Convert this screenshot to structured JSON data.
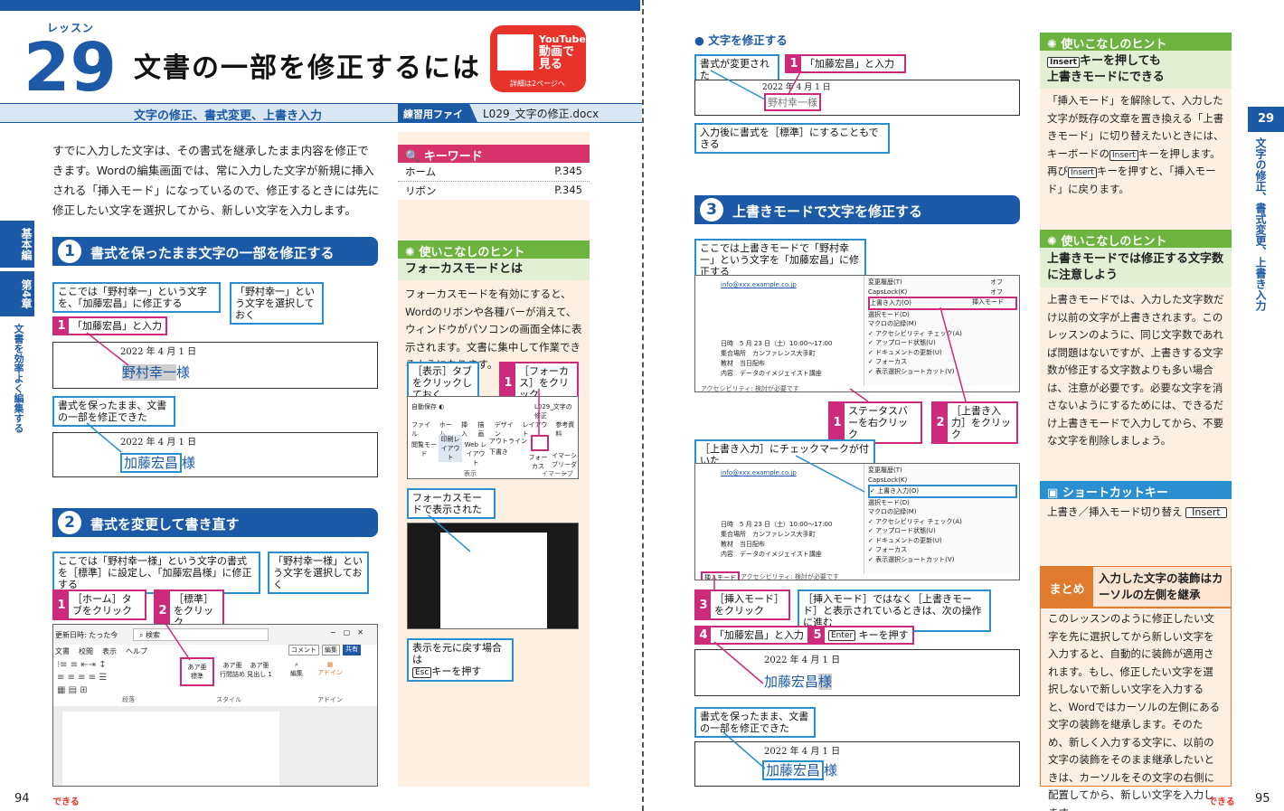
{
  "left": {
    "lesson_label": "レッスン",
    "lesson_number": "29",
    "title": "文書の一部を修正するには",
    "youtube": {
      "line1": "YouTube",
      "line2": "動画で",
      "line3": "見る",
      "note": "詳細は2ページへ"
    },
    "subtitle": "文字の修正、書式変更、上書き入力",
    "practice_label": "練習用ファイル",
    "practice_file": "L029_文字の修正.docx",
    "intro": "すでに入力した文字は、その書式を継承したまま内容を修正できます。Wordの編集画面では、常に入力した文字が新規に挿入される「挿入モード」になっているので、修正するときには先に修正したい文字を選択してから、新しい文字を入力します。",
    "side_tabs": [
      "基本編",
      "第4章",
      "文書を効率よく編集する"
    ],
    "sec1": {
      "no": "1",
      "title": "書式を保ったまま文字の一部を修正する",
      "c1": "ここでは「野村幸一」という文字を、「加藤宏昌」に修正する",
      "c2": "「野村幸一」という文字を選択しておく",
      "step_no": "1",
      "step": "「加藤宏昌」と入力",
      "date": "2022 年 4 月 1 日",
      "old": "野村幸一",
      "sama": "様",
      "c3": "書式を保ったまま、文書の一部を修正できた",
      "new": "加藤宏昌"
    },
    "sec2": {
      "no": "2",
      "title": "書式を変更して書き直す",
      "c1": "ここでは「野村幸一様」という文字の書式を［標準］に設定し、「加藤宏昌様」に修正する",
      "c2": "「野村幸一様」という文字を選択しておく",
      "s1_no": "1",
      "s1": "［ホーム］タブをクリック",
      "s2_no": "2",
      "s2": "［標準］をクリック",
      "ribbon": {
        "autosave": "更新日時: たった今",
        "search": "検索",
        "tabs": [
          "文書",
          "校閲",
          "表示",
          "ヘルプ"
        ],
        "comment": "コメント",
        "edit": "編集",
        "share": "共有",
        "style1": "あア亜",
        "style1b": "標準",
        "style2": "あア亜",
        "style2b": "行間詰め",
        "style3": "あア亜",
        "style3b": "見出し 1",
        "grp1": "段落",
        "grp2": "スタイル",
        "grp3": "アドイン",
        "edit2": "編集",
        "addin": "アドイン"
      }
    },
    "keyword": {
      "title": "キーワード",
      "items": [
        {
          "label": "ホーム",
          "page": "P.345"
        },
        {
          "label": "リボン",
          "page": "P.345"
        }
      ]
    },
    "hint1": {
      "title": "使いこなしのヒント",
      "sub": "フォーカスモードとは",
      "body": "フォーカスモードを有効にすると、Wordのリボンや各種バーが消えて、ウィンドウがパソコンの画面全体に表示されます。文書に集中して作業できるようになります。",
      "c1": "［表示］タブをクリックしておく",
      "s1_no": "1",
      "s1": "［フォーカス］をクリック",
      "ribbon": {
        "autosave": "自動保存",
        "file": "L029_文字の修正",
        "tabs": [
          "ファイル",
          "ホーム",
          "挿入",
          "描画",
          "デザイン",
          "レイアウト",
          "参考資料"
        ],
        "b1": "閲覧モード",
        "b2": "印刷レイアウト",
        "b3": "Web レイアウト",
        "b4": "アウトライン",
        "b5": "下書き",
        "b6": "フォーカス",
        "b7": "イマーシブリーダー",
        "g1": "表示",
        "g2": "イマーシブ"
      },
      "c2": "フォーカスモードで表示された",
      "c3a": "表示を元に戻す場合は",
      "c3_key": "Esc",
      "c3b": "キーを押す"
    }
  },
  "right": {
    "head": "文字を修正する",
    "top": {
      "c1": "書式が変更された",
      "s1_no": "1",
      "s1": "「加藤宏昌」と入力",
      "date": "2022 年 4 月 1 日",
      "text": "野村幸一様",
      "c2": "入力後に書式を［標準］にすることもできる"
    },
    "sec3": {
      "no": "3",
      "title": "上書きモードで文字を修正する",
      "c1": "ここでは上書きモードで「野村幸一」という文字を「加藤宏昌」に修正する",
      "s1_no": "1",
      "s1": "ステータスバーを右クリック",
      "s2_no": "2",
      "s2": "［上書き入力］をクリック",
      "c2": "［上書き入力］にチェックマークが付いた",
      "s3_no": "3",
      "s3": "［挿入モード］をクリック",
      "c3": "［挿入モード］ではなく［上書きモード］と表示されているときは、次の操作に進む",
      "s4_no": "4",
      "s4": "「加藤宏昌」と入力",
      "s5_no": "5",
      "s5_key": "Enter",
      "s5": "キーを押す",
      "date": "2022 年 4 月 1 日",
      "new": "加藤宏昌",
      "sama": "様",
      "c4": "書式を保ったまま、文書の一部を修正できた",
      "email": "info@xxx.example.co.jp",
      "doc_lines": [
        "日時　5 月 23 日（土）10:00〜17:00",
        "集合場所　カンファレンス大手町",
        "教材　当日配布",
        "内容　データのイメジェイスト講座"
      ],
      "status": "アクセシビリティ: 検討が必要です",
      "status_mode": "挿入モード",
      "menu": [
        "変更履歴(T)",
        "CapsLock(K)",
        "上書き入力(O)",
        "選択モード(D)",
        "マクロの記録(M)",
        "アクセシビリティ チェック(A)",
        "アップロード状態(U)",
        "ドキュメントの更新(U)",
        "フォーカス",
        "表示選択ショートカット(V)"
      ],
      "menu_right": [
        "オフ",
        "オフ",
        "挿入モード",
        "",
        "記録停止中",
        "アクセシビリティ: 検討が必要です"
      ]
    },
    "hint2": {
      "title": "使いこなしのヒント",
      "key": "Insert",
      "sub1": "キーを押しても",
      "sub2": "上書きモードにできる",
      "body1": "「挿入モード」を解除して、入力した文字が既存の文章を置き換える「上書きモード」に切り替えたいときには、キーボードの",
      "body2": "キーを押します。再び",
      "body3": "キーを押すと、「挿入モード」に戻ります。"
    },
    "hint3": {
      "title": "使いこなしのヒント",
      "sub": "上書きモードでは修正する文字数に注意しよう",
      "body": "上書きモードでは、入力した文字数だけ以前の文字が上書きされます。このレッスンのように、同じ文字数であれば問題はないですが、上書きする文字数が修正する文字数よりも多い場合は、注意が必要です。必要な文字を消さないようにするためには、できるだけ上書きモードで入力してから、不要な文字を削除しましょう。"
    },
    "shortcut": {
      "title": "ショートカットキー",
      "label": "上書き／挿入モード切り替え",
      "key": "Insert"
    },
    "summary": {
      "badge": "まとめ",
      "title": "入力した文字の装飾はカーソルの左側を継承",
      "body": "このレッスンのように修正したい文字を先に選択してから新しい文字を入力すると、自動的に装飾が適用されます。もし、修正したい文字を選択しないで新しい文字を入力すると、Wordではカーソルの左側にある文字の装飾を継承します。そのため、新しく入力する文字に、以前の文字の装飾をそのまま継承したいときは、カーソルをその文字の右側に配置してから、新しい文字を入力します。"
    },
    "vtab_no": "29",
    "vtab_text": "文字の修正、書式変更、上書き入力"
  },
  "footer": {
    "left_page": "94",
    "right_page": "95",
    "brand": "できる"
  },
  "colors": {
    "blue": "#1c5aa8",
    "magenta": "#cc2a7a",
    "callout": "#2a8fd0",
    "green": "#6db33f",
    "orange": "#e07a2c",
    "cream": "#fdf0e3"
  }
}
